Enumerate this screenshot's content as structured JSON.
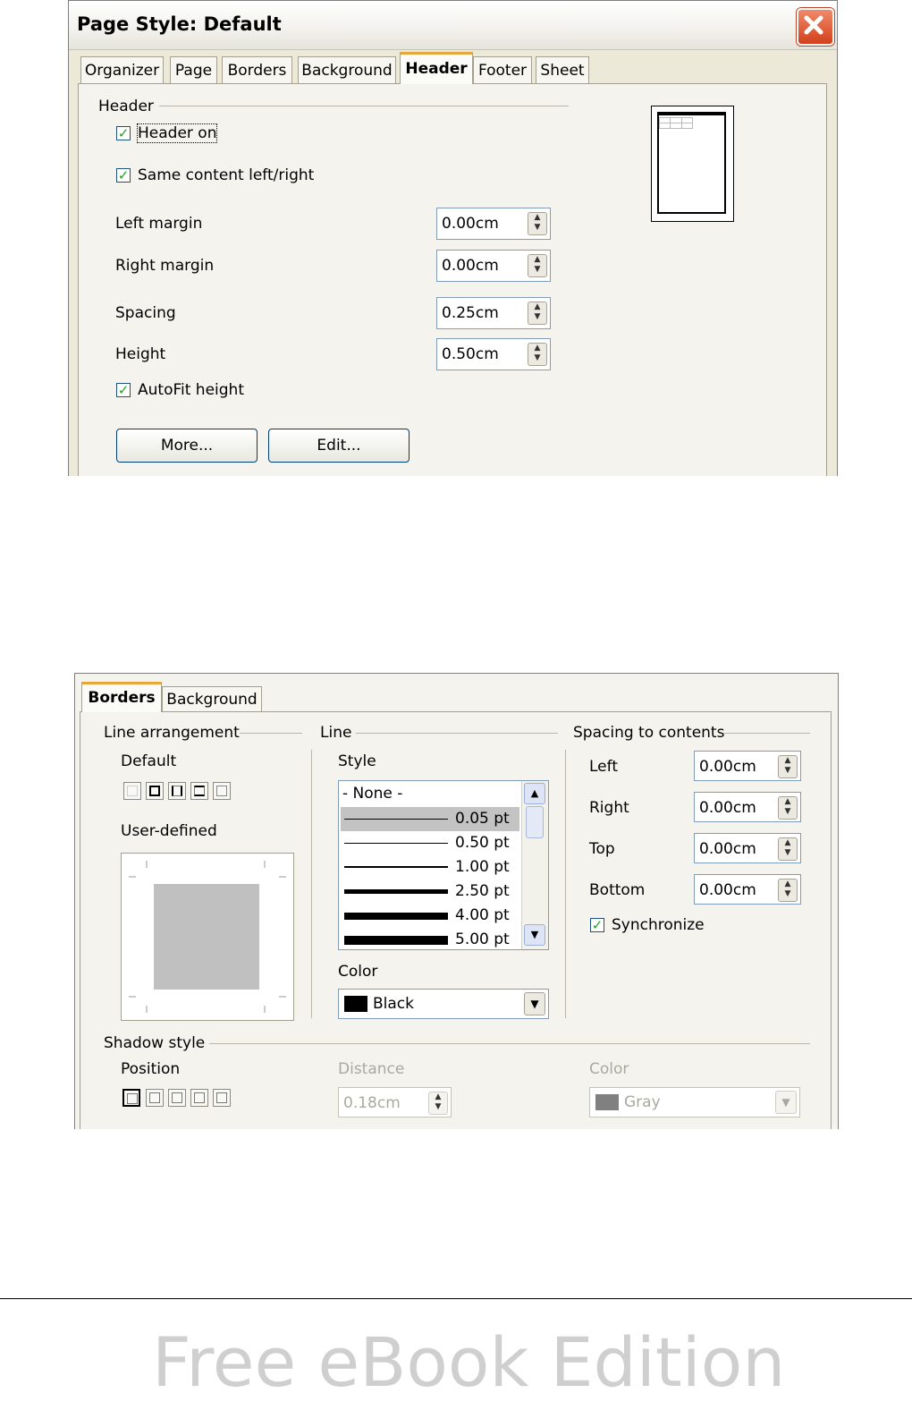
{
  "dialog1": {
    "title": "Page Style: Default",
    "tabs": [
      "Organizer",
      "Page",
      "Borders",
      "Background",
      "Header",
      "Footer",
      "Sheet"
    ],
    "active_tab": "Header",
    "section_header": "Header",
    "header_on": {
      "label": "Header on",
      "checked": true
    },
    "same_content": {
      "label": "Same content left/right",
      "checked": true
    },
    "fields": [
      {
        "label": "Left margin",
        "value": "0.00cm"
      },
      {
        "label": "Right margin",
        "value": "0.00cm"
      },
      {
        "label": "Spacing",
        "value": "0.25cm"
      },
      {
        "label": "Height",
        "value": "0.50cm"
      }
    ],
    "autofit": {
      "label": "AutoFit height",
      "checked": true
    },
    "more_button": "More...",
    "edit_button": "Edit..."
  },
  "dialog2": {
    "tabs": [
      "Borders",
      "Background"
    ],
    "active_tab": "Borders",
    "line_arrangement": {
      "title": "Line arrangement",
      "default_label": "Default",
      "user_defined_label": "User-defined"
    },
    "line": {
      "title": "Line",
      "style_label": "Style",
      "styles": [
        "- None -",
        "0.05 pt",
        "0.50 pt",
        "1.00 pt",
        "2.50 pt",
        "4.00 pt",
        "5.00 pt"
      ],
      "selected_style": "0.05 pt",
      "color_label": "Color",
      "color_value": "Black",
      "color_swatch": "#000000"
    },
    "spacing": {
      "title": "Spacing to contents",
      "fields": [
        {
          "label": "Left",
          "value": "0.00cm"
        },
        {
          "label": "Right",
          "value": "0.00cm"
        },
        {
          "label": "Top",
          "value": "0.00cm"
        },
        {
          "label": "Bottom",
          "value": "0.00cm"
        }
      ],
      "synchronize": {
        "label": "Synchronize",
        "checked": true
      }
    },
    "shadow": {
      "title": "Shadow style",
      "position_label": "Position",
      "distance_label": "Distance",
      "distance_value": "0.18cm",
      "color_label": "Color",
      "color_value": "Gray",
      "color_swatch": "#808080"
    }
  },
  "footer": {
    "watermark": "Free eBook Edition"
  }
}
